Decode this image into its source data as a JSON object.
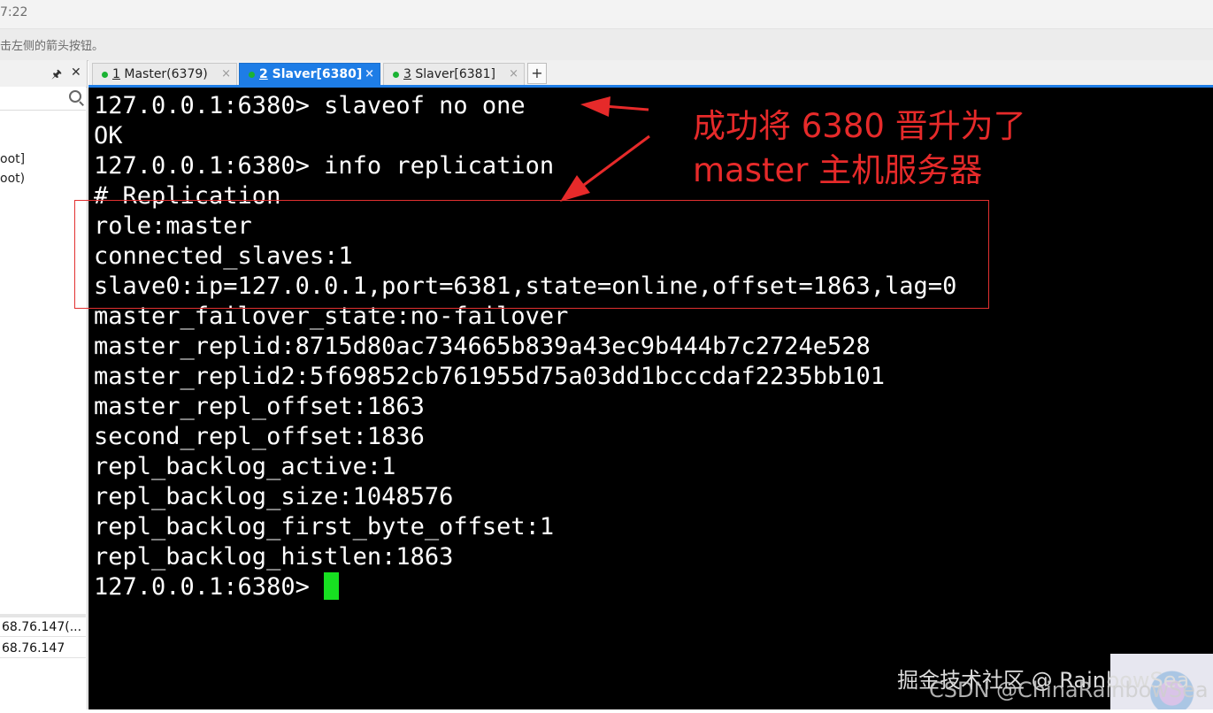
{
  "top": {
    "time": "7:22",
    "hint": "击左侧的箭头按钮。"
  },
  "sidebar": {
    "pin_icon": "pin-icon",
    "close_icon": "close-icon",
    "search_icon": "search-icon",
    "tree_items": [
      "oot]",
      "oot)"
    ],
    "sessions": [
      "68.76.147(...",
      "68.76.147"
    ]
  },
  "tabs": [
    {
      "number": "1",
      "title": "Master(6379)",
      "active": false
    },
    {
      "number": "2",
      "title": "Slaver[6380]",
      "active": true
    },
    {
      "number": "3",
      "title": "Slaver[6381]",
      "active": false
    }
  ],
  "tab_close": "×",
  "add_tab": "+",
  "terminal": {
    "lines": [
      "127.0.0.1:6380> slaveof no one",
      "OK",
      "127.0.0.1:6380> info replication",
      "# Replication",
      "role:master",
      "connected_slaves:1",
      "slave0:ip=127.0.0.1,port=6381,state=online,offset=1863,lag=0",
      "master_failover_state:no-failover",
      "master_replid:8715d80ac734665b839a43ec9b444b7c2724e528",
      "master_replid2:5f69852cb761955d75a03dd1bcccdaf2235bb101",
      "master_repl_offset:1863",
      "second_repl_offset:1836",
      "repl_backlog_active:1",
      "repl_backlog_size:1048576",
      "repl_backlog_first_byte_offset:1",
      "repl_backlog_histlen:1863"
    ],
    "prompt": "127.0.0.1:6380> ",
    "cursor_color": "#17e021"
  },
  "annotation": {
    "line1": "成功将 6380 晋升为了",
    "line2": "master 主机服务器",
    "color": "#e62a2a"
  },
  "watermark": {
    "line1": "掘金技术社区 @ RainbowSea",
    "line2": "CSDN @ChinaRainbowSea"
  }
}
